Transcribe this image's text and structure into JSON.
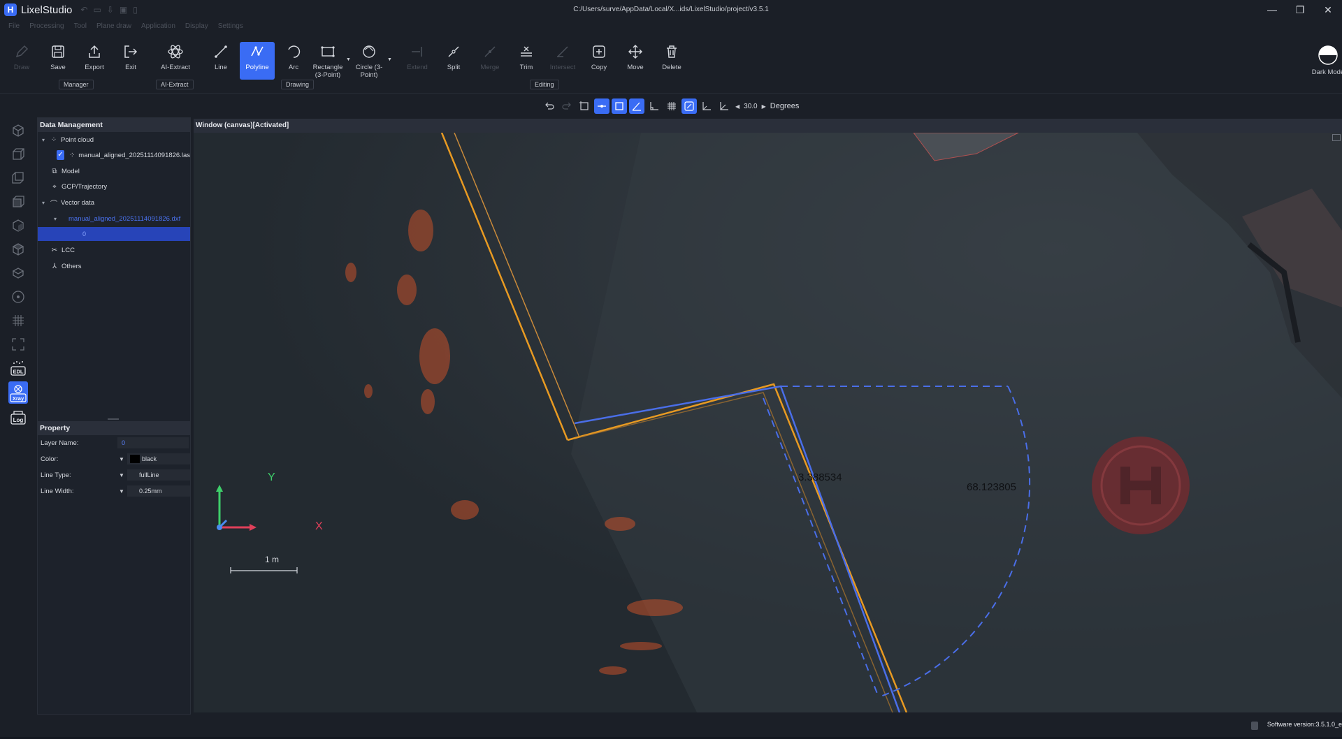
{
  "app": {
    "name": "LixelStudio",
    "title_path": "C:/Users/surve/AppData/Local/X...ids/LixelStudio/project/v3.5.1"
  },
  "menu": [
    "File",
    "Processing",
    "Tool",
    "Plane draw",
    "Application",
    "Display",
    "Settings"
  ],
  "ribbon": {
    "draw": "Draw",
    "save": "Save",
    "export": "Export",
    "exit": "Exit",
    "ai_extract": "AI-Extract",
    "line": "Line",
    "polyline": "Polyline",
    "arc": "Arc",
    "rectangle": "Rectangle (3-Point)",
    "circle": "Circle (3-Point)",
    "extend": "Extend",
    "split": "Split",
    "merge": "Merge",
    "trim": "Trim",
    "intersect": "Intersect",
    "copy": "Copy",
    "move": "Move",
    "delete": "Delete",
    "dark_mode": "Dark Mode",
    "groups": {
      "manager": "Manager",
      "ai_extract": "AI-Extract",
      "drawing": "Drawing",
      "editing": "Editing"
    }
  },
  "canvas_toolbar": {
    "angle_value": "30.0",
    "angle_unit": "Degrees"
  },
  "left_strip": {
    "edl": "EDL",
    "xray": "Xray",
    "log": "Log"
  },
  "data_management": {
    "title": "Data Management",
    "point_cloud": "Point cloud",
    "point_cloud_file": "manual_aligned_20251114091826.las",
    "model": "Model",
    "gcp": "GCP/Trajectory",
    "vector_data": "Vector data",
    "vector_file": "manual_aligned_20251114091826.dxf",
    "layer_0": "0",
    "lcc": "LCC",
    "others": "Others"
  },
  "property": {
    "title": "Property",
    "layer_name_key": "Layer Name:",
    "layer_name_val": "0",
    "color_key": "Color:",
    "color_val": "black",
    "line_type_key": "Line Type:",
    "line_type_val": "fullLine",
    "line_width_key": "Line Width:",
    "line_width_val": "0.25mm"
  },
  "canvas": {
    "title": "Window (canvas)[Activated]",
    "measure_length": "3.388534",
    "measure_angle": "68.123805",
    "axis_y": "Y",
    "axis_x": "X",
    "scale_label": "1 m"
  },
  "status": {
    "software_version": "Software version:3.5.1.0_e"
  },
  "colors": {
    "accent": "#3a6cf4",
    "selection": "#2744b8",
    "feature_line": "#e89a22",
    "dimension_line": "#4a6ee8"
  }
}
